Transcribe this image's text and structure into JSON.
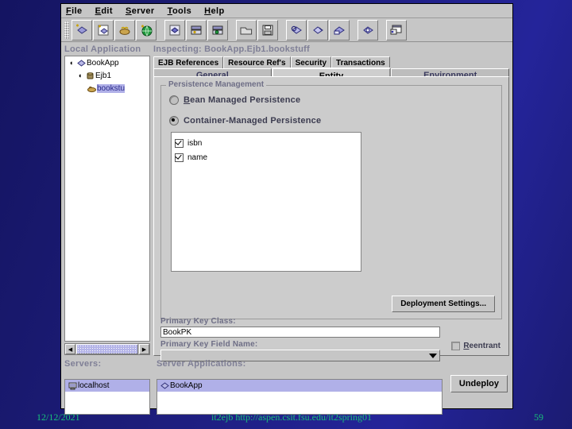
{
  "window": {
    "menus": [
      {
        "label": "File",
        "accel": "F"
      },
      {
        "label": "Edit",
        "accel": "E"
      },
      {
        "label": "Server",
        "accel": "S"
      },
      {
        "label": "Tools",
        "accel": "T"
      },
      {
        "label": "Help",
        "accel": "H"
      }
    ],
    "toolbar": [
      {
        "name": "new-application-icon"
      },
      {
        "name": "new-ejb-icon"
      },
      {
        "name": "new-bean-icon"
      },
      {
        "name": "new-web-icon"
      },
      {
        "name": "edit-icon"
      },
      {
        "name": "deploy-icon"
      },
      {
        "name": "deploy-settings-icon"
      },
      {
        "name": "open-folder-icon"
      },
      {
        "name": "save-icon"
      },
      {
        "name": "verify-icon"
      },
      {
        "name": "inspect-icon"
      },
      {
        "name": "server-icon"
      },
      {
        "name": "monitor-icon"
      },
      {
        "name": "window-icon"
      }
    ]
  },
  "left_panel": {
    "title": "Local Application",
    "tree": [
      {
        "label": "BookApp",
        "icon": "application-icon",
        "depth": 0,
        "handle": "expanded",
        "selected": false
      },
      {
        "label": "Ejb1",
        "icon": "ejb-jar-icon",
        "depth": 1,
        "handle": "expanded",
        "selected": false
      },
      {
        "label": "bookstu",
        "icon": "bean-icon",
        "depth": 2,
        "handle": "none",
        "selected": true
      }
    ],
    "scrollbar": {
      "left_arrow": "◀",
      "right_arrow": "▶"
    }
  },
  "right_panel": {
    "inspecting": "Inspecting: BookApp.Ejb1.bookstuff",
    "secondary_tabs": [
      {
        "label": "EJB References"
      },
      {
        "label": "Resource Ref's"
      },
      {
        "label": "Security"
      },
      {
        "label": "Transactions"
      }
    ],
    "main_tabs": [
      {
        "label": "General",
        "active": false
      },
      {
        "label": "Entity",
        "active": true
      },
      {
        "label": "Environment",
        "active": false
      }
    ],
    "entity": {
      "group_title": "Persistence Management",
      "radios": [
        {
          "label": "Bean  Managed Persistence",
          "accel": "B",
          "rest": "ean  Managed Persistence",
          "selected": false
        },
        {
          "label": "Container-Managed Persistence",
          "accel": "",
          "rest": "Container-Managed Persistence",
          "selected": true
        }
      ],
      "fields": [
        {
          "label": "isbn",
          "checked": true
        },
        {
          "label": "name",
          "checked": true
        }
      ],
      "deployment_settings_button": "Deployment Settings...",
      "primary_key_class_label": "Primary Key Class:",
      "primary_key_class_value": "BookPK",
      "primary_key_field_label": "Primary Key Field Name:",
      "primary_key_field_value": "",
      "reentrant": {
        "accel": "R",
        "rest": "eentrant",
        "checked": false
      }
    }
  },
  "bottom": {
    "servers_label": "Servers:",
    "servers": [
      {
        "label": "localhost",
        "icon": "computer-icon",
        "selected": true
      }
    ],
    "apps_label": "Server Applications:",
    "apps": [
      {
        "label": "BookApp",
        "icon": "application-icon",
        "selected": true
      }
    ],
    "undeploy_button": "Undeploy"
  },
  "footer": {
    "date": "12/12/2021",
    "center": "it2ejb  http://aspen.csit.fsu.edu/it2spring01",
    "page": "59"
  }
}
